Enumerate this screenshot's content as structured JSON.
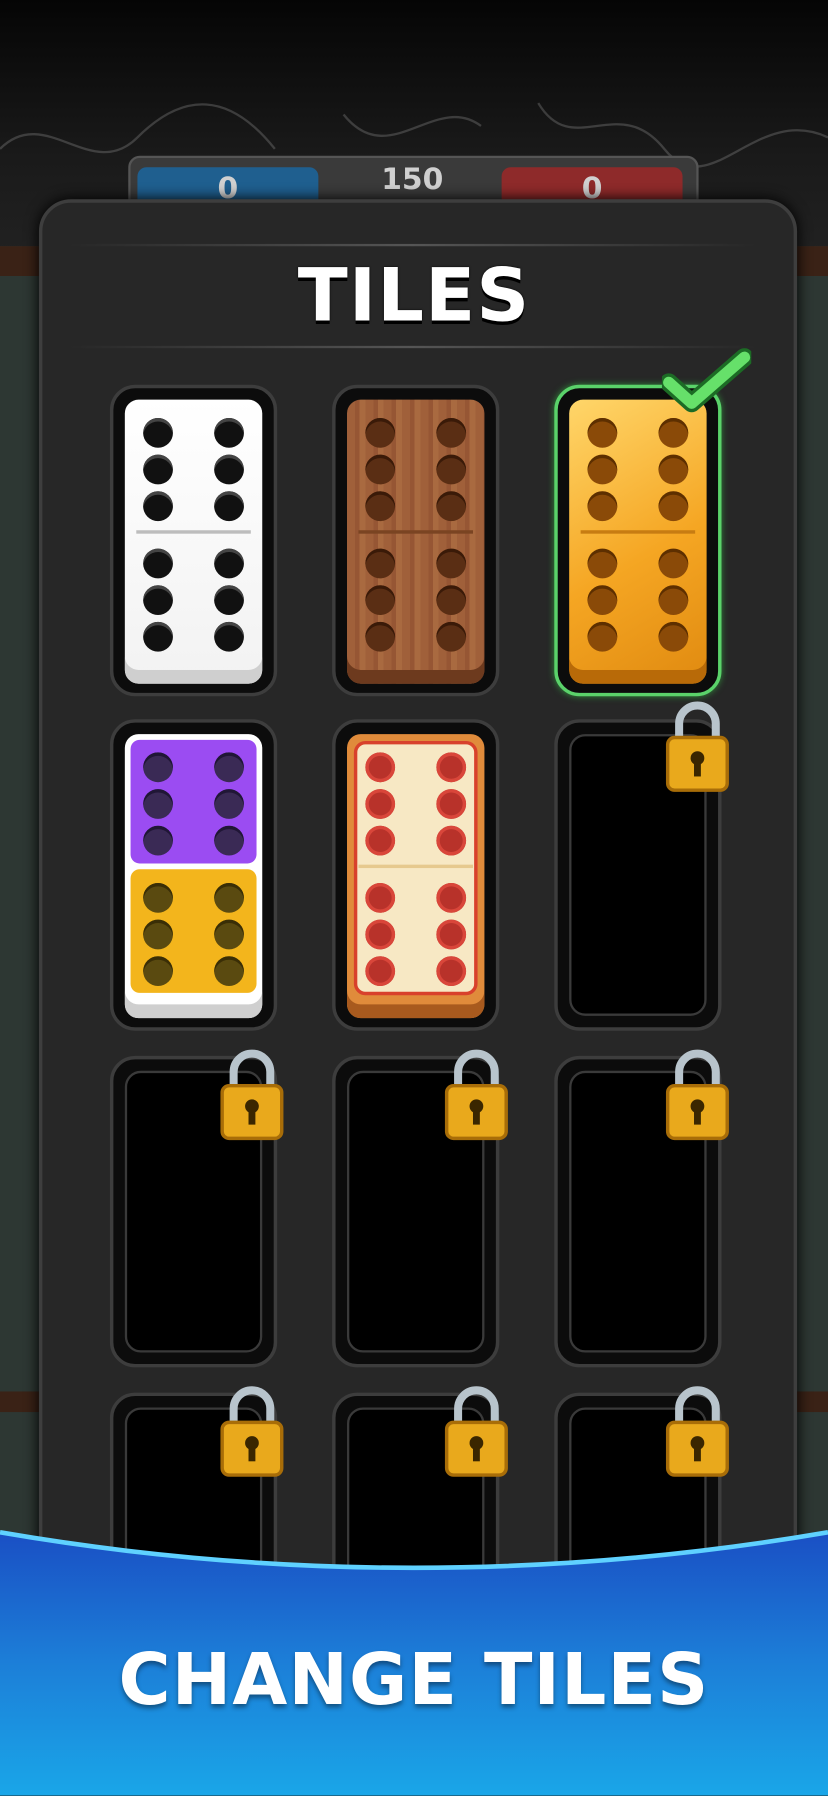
{
  "scoreboard": {
    "left_score": "0",
    "target": "150",
    "right_score": "0"
  },
  "panel": {
    "title": "TILES"
  },
  "tiles": [
    {
      "style": "classic-white",
      "selected": false,
      "locked": false
    },
    {
      "style": "wood",
      "selected": false,
      "locked": false
    },
    {
      "style": "gold",
      "selected": true,
      "locked": false
    },
    {
      "style": "purple-yellow",
      "selected": false,
      "locked": false
    },
    {
      "style": "pizza",
      "selected": false,
      "locked": false
    },
    {
      "style": "locked",
      "selected": false,
      "locked": true
    },
    {
      "style": "locked",
      "selected": false,
      "locked": true
    },
    {
      "style": "locked",
      "selected": false,
      "locked": true
    },
    {
      "style": "locked",
      "selected": false,
      "locked": true
    },
    {
      "style": "locked",
      "selected": false,
      "locked": true
    },
    {
      "style": "locked",
      "selected": false,
      "locked": true
    },
    {
      "style": "locked",
      "selected": false,
      "locked": true
    }
  ],
  "icons": {
    "selected": "checkmark-icon",
    "locked": "padlock-icon"
  },
  "colors": {
    "selected_border": "#5ad26a",
    "banner_blue": "#1f6fd0",
    "score_blue": "#1f5f8f",
    "score_red": "#8e2a2a"
  },
  "banner": {
    "text": "CHANGE TILES"
  }
}
